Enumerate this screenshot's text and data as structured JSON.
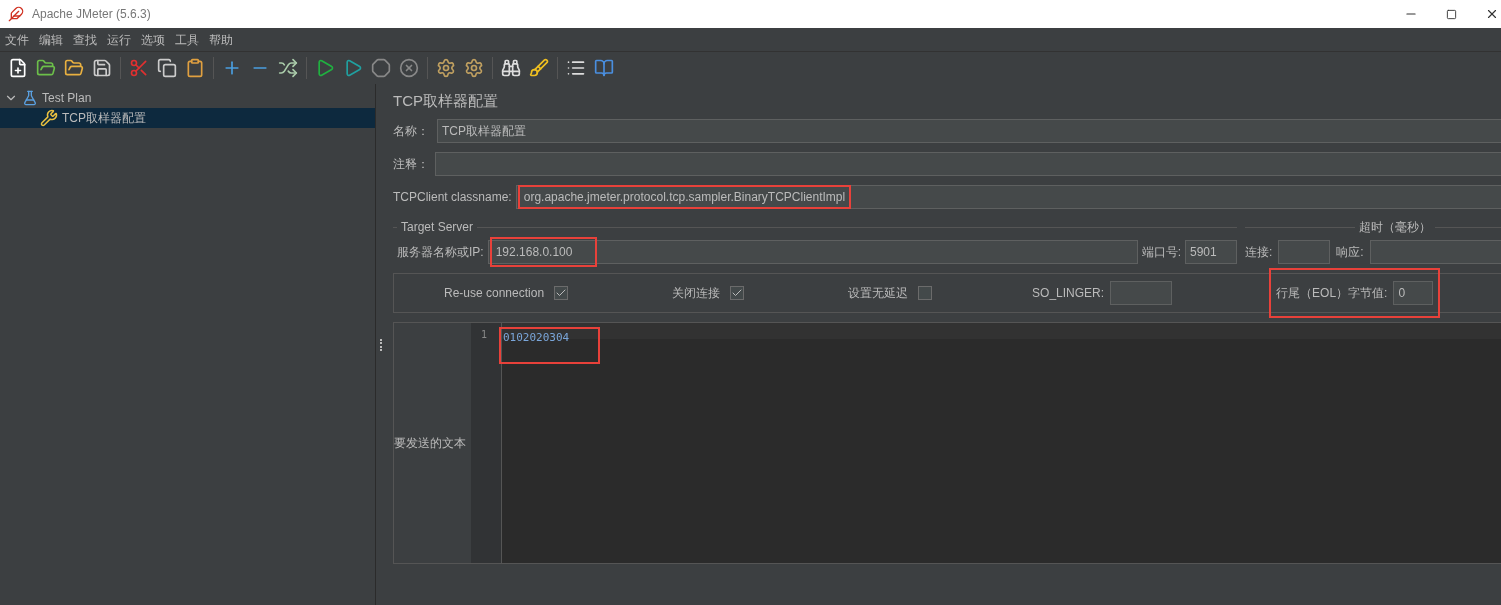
{
  "window": {
    "title": "Apache JMeter (5.6.3)"
  },
  "menu": [
    "文件",
    "编辑",
    "查找",
    "运行",
    "选项",
    "工具",
    "帮助"
  ],
  "tree": {
    "items": [
      {
        "label": "Test Plan",
        "expanded": true,
        "selected": false,
        "children": [
          {
            "label": "TCP取样器配置",
            "selected": true
          }
        ]
      }
    ]
  },
  "panel": {
    "title": "TCP取样器配置",
    "name": {
      "label": "名称：",
      "value": "TCP取样器配置"
    },
    "comment": {
      "label": "注释："
    },
    "classname": {
      "label": "TCPClient classname:",
      "value": "org.apache.jmeter.protocol.tcp.sampler.BinaryTCPClientImpl",
      "highlighted": true
    },
    "target_server": {
      "legend": "Target Server",
      "server": {
        "label": "服务器名称或IP:",
        "value": "192.168.0.100",
        "highlighted": true
      },
      "port": {
        "label": "端口号:",
        "value": "5901"
      }
    },
    "timeout": {
      "legend": "超时（毫秒）",
      "connect": {
        "label": "连接:"
      },
      "response": {
        "label": "响应:"
      }
    },
    "options": [
      {
        "label": "Re-use connection",
        "checked": true
      },
      {
        "label": "关闭连接",
        "checked": true
      },
      {
        "label": "设置无延迟",
        "checked": false
      }
    ],
    "so_linger": {
      "label": "SO_LINGER:"
    },
    "eol": {
      "label": "行尾（EOL）字节值:",
      "value": "0",
      "highlighted": true
    },
    "text_to_send": {
      "label": "要发送的文本",
      "lines": [
        {
          "number": "1",
          "text": "0102020304"
        }
      ],
      "highlighted": true
    }
  }
}
